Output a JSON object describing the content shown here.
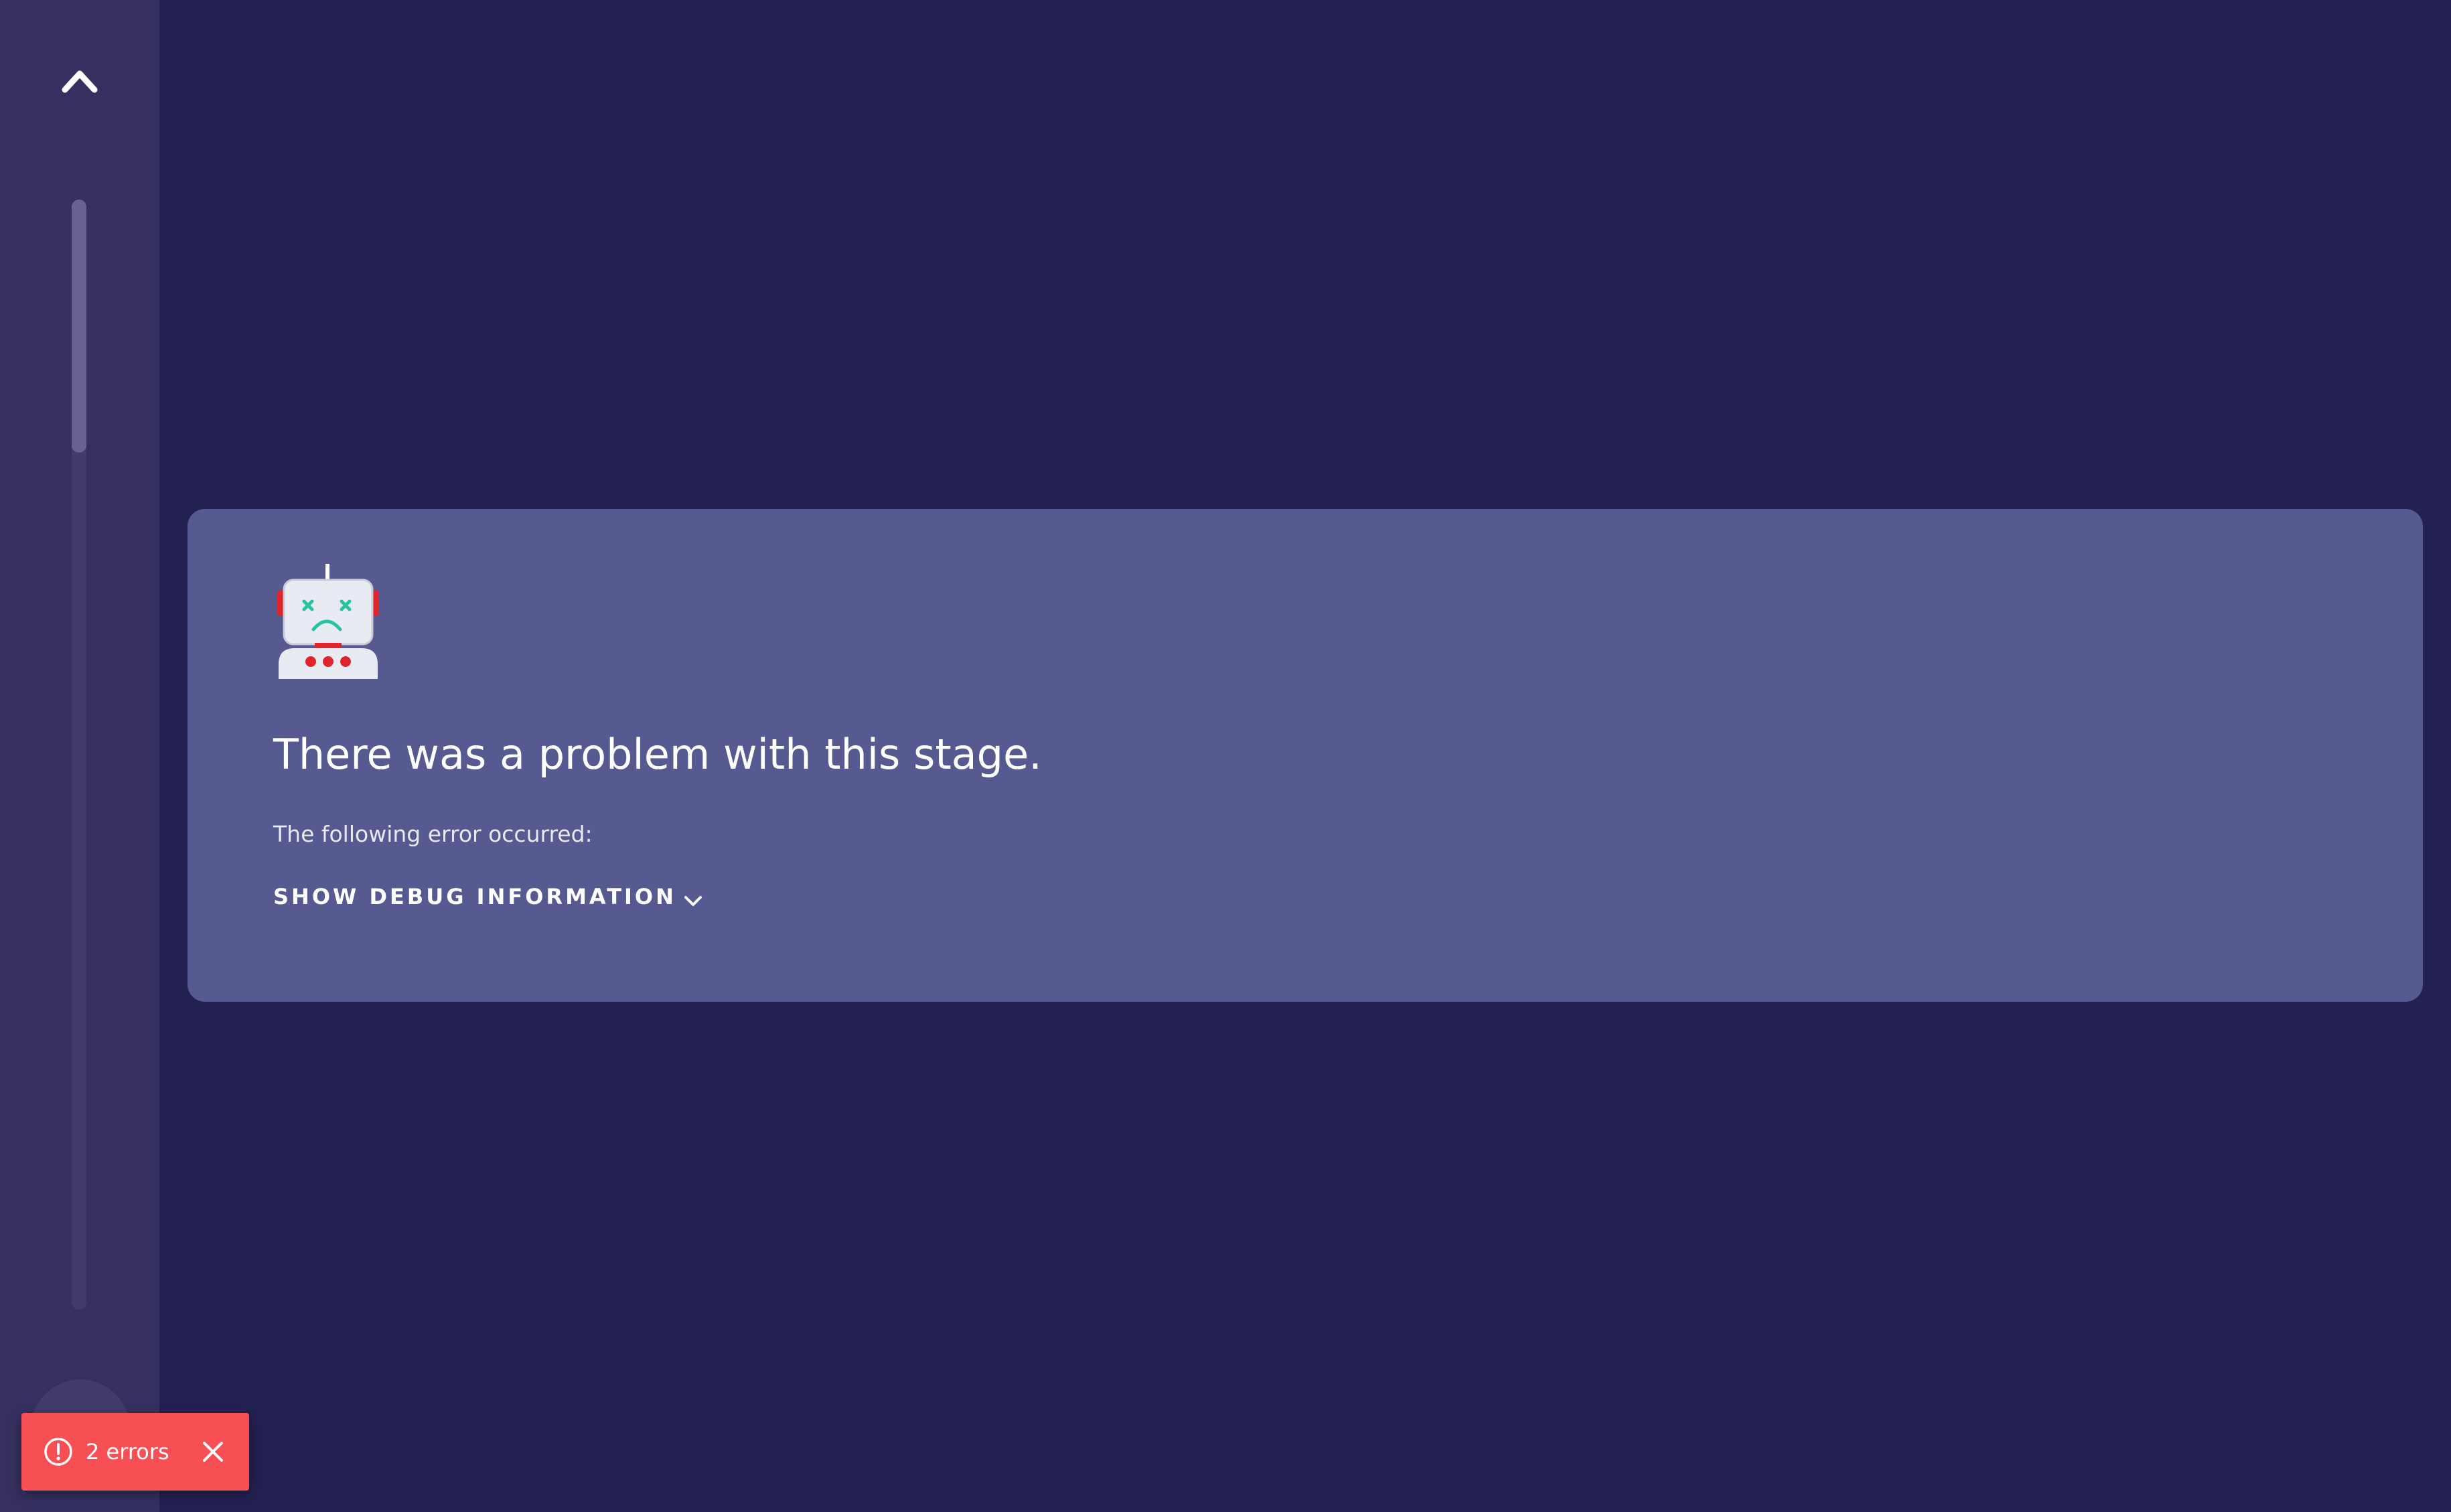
{
  "sidebar": {
    "collapse_icon": "chevron-up-icon"
  },
  "error_card": {
    "illustration": "sad-robot-icon",
    "title": "There was a problem with this stage.",
    "message": "The following error occurred:",
    "debug_toggle_label": "SHOW DEBUG INFORMATION",
    "debug_toggle_icon": "chevron-down-icon"
  },
  "error_toast": {
    "icon": "alert-circle-icon",
    "text": "2 errors",
    "close_icon": "close-icon"
  },
  "colors": {
    "page_background": "#232052",
    "sidebar_background": "#35305f",
    "card_background": "#565a90",
    "toast_background": "#f74f53",
    "robot_accent": "#e0242c",
    "robot_face": "#27c2a0"
  }
}
